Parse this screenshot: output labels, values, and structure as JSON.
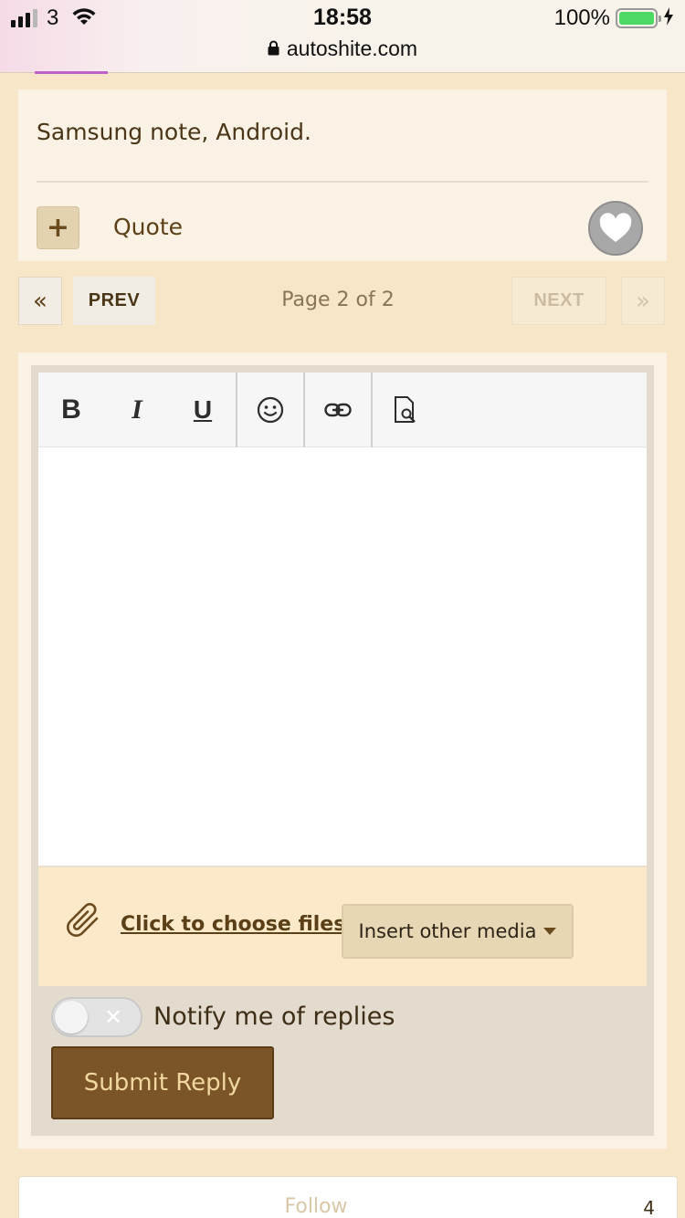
{
  "status_bar": {
    "carrier": "3",
    "time": "18:58",
    "battery_percent": "100%",
    "battery_level": 1.0,
    "url": "autoshite.com"
  },
  "post": {
    "text": "Samsung note, Android.",
    "quote_label": "Quote",
    "add_icon": "plus-icon",
    "like_icon": "heart-icon"
  },
  "pagination": {
    "first_icon": "«",
    "prev_label": "PREV",
    "page_info": "Page 2 of 2",
    "next_label": "NEXT",
    "last_icon": "»"
  },
  "editor": {
    "toolbar": {
      "bold": "B",
      "italic": "I",
      "underline": "U",
      "emoji_icon": "smiley-icon",
      "link_icon": "link-icon",
      "preview_icon": "preview-icon"
    },
    "text_value": "",
    "choose_files_label": "Click to choose files",
    "insert_media_label": "Insert other media"
  },
  "notify": {
    "label": "Notify me of replies",
    "enabled": false
  },
  "submit_label": "Submit Reply",
  "follow": {
    "label": "Follow",
    "count": "4"
  },
  "colors": {
    "page_bg": "#f7e6c8",
    "brand_brown": "#7b5427",
    "submit_text": "#f0d89e",
    "accent_line": "#c060c8"
  }
}
